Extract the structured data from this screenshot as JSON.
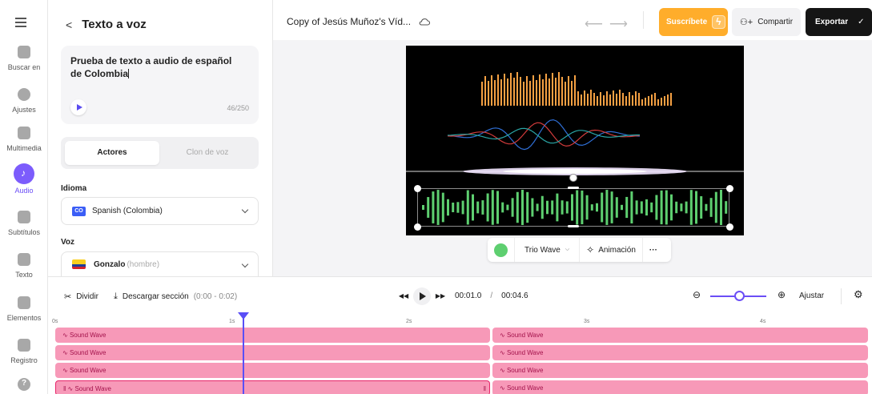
{
  "sidebar": {
    "items": [
      {
        "label": "Buscar en",
        "icon": "search-icon"
      },
      {
        "label": "Ajustes",
        "icon": "settings-icon"
      },
      {
        "label": "Multimedia",
        "icon": "plus-icon"
      },
      {
        "label": "Audio",
        "icon": "music-icon",
        "active": true
      },
      {
        "label": "Subtítulos",
        "icon": "subtitles-icon"
      },
      {
        "label": "Texto",
        "icon": "text-icon"
      },
      {
        "label": "Elementos",
        "icon": "elements-icon"
      },
      {
        "label": "Registro",
        "icon": "record-icon"
      }
    ]
  },
  "panel": {
    "title": "Texto a voz",
    "text": "Prueba de texto a audio de español de Colombia",
    "counter": "46/250",
    "tabs": [
      "Actores",
      "Clon de voz"
    ],
    "language_label": "Idioma",
    "language_code": "CO",
    "language_value": "Spanish (Colombia)",
    "voice_label": "Voz",
    "voice_name": "Gonzalo",
    "voice_gender": "(hombre)"
  },
  "header": {
    "project": "Copy of Jesús Muñoz's Víd...",
    "subscribe": "Suscríbete",
    "share": "Compartir",
    "export": "Exportar"
  },
  "toolbar": {
    "style": "Trio Wave",
    "animation": "Animación",
    "more": "···"
  },
  "timeline": {
    "split": "Dividir",
    "download": "Descargar sección",
    "download_range": "(0:00 - 0:02)",
    "current": "00:01.0",
    "sep": "/",
    "total": "00:04.6",
    "fit": "Ajustar",
    "ruler": [
      "0s",
      "1s",
      "2s",
      "3s",
      "4s"
    ],
    "clip_label": "Sound Wave"
  },
  "colors": {
    "accent": "#6b4ef6",
    "subscribe": "#ffad2b",
    "clip": "#f799b8",
    "wave_green": "#5ecf70",
    "wave_orange": "#f5a043"
  }
}
